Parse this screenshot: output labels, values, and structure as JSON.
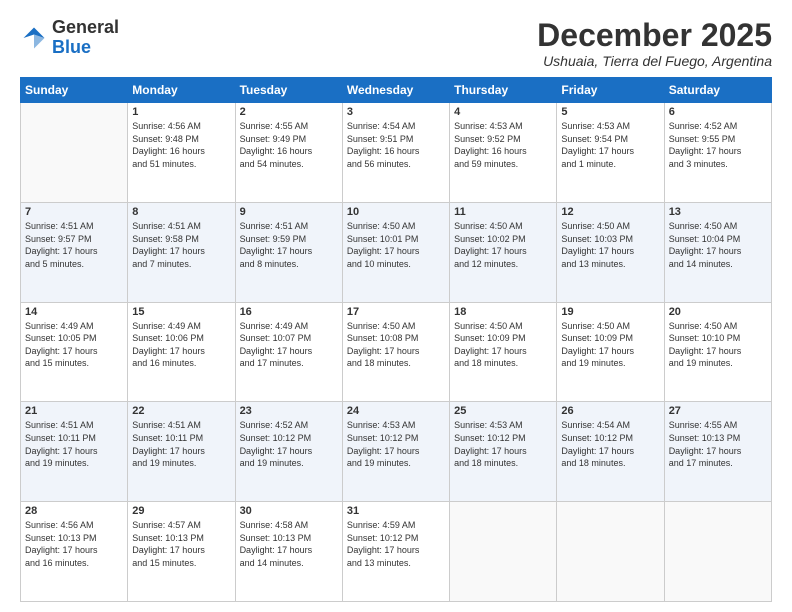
{
  "logo": {
    "general": "General",
    "blue": "Blue"
  },
  "header": {
    "month": "December 2025",
    "subtitle": "Ushuaia, Tierra del Fuego, Argentina"
  },
  "weekdays": [
    "Sunday",
    "Monday",
    "Tuesday",
    "Wednesday",
    "Thursday",
    "Friday",
    "Saturday"
  ],
  "weeks": [
    [
      {
        "day": "",
        "info": ""
      },
      {
        "day": "1",
        "info": "Sunrise: 4:56 AM\nSunset: 9:48 PM\nDaylight: 16 hours\nand 51 minutes."
      },
      {
        "day": "2",
        "info": "Sunrise: 4:55 AM\nSunset: 9:49 PM\nDaylight: 16 hours\nand 54 minutes."
      },
      {
        "day": "3",
        "info": "Sunrise: 4:54 AM\nSunset: 9:51 PM\nDaylight: 16 hours\nand 56 minutes."
      },
      {
        "day": "4",
        "info": "Sunrise: 4:53 AM\nSunset: 9:52 PM\nDaylight: 16 hours\nand 59 minutes."
      },
      {
        "day": "5",
        "info": "Sunrise: 4:53 AM\nSunset: 9:54 PM\nDaylight: 17 hours\nand 1 minute."
      },
      {
        "day": "6",
        "info": "Sunrise: 4:52 AM\nSunset: 9:55 PM\nDaylight: 17 hours\nand 3 minutes."
      }
    ],
    [
      {
        "day": "7",
        "info": "Sunrise: 4:51 AM\nSunset: 9:57 PM\nDaylight: 17 hours\nand 5 minutes."
      },
      {
        "day": "8",
        "info": "Sunrise: 4:51 AM\nSunset: 9:58 PM\nDaylight: 17 hours\nand 7 minutes."
      },
      {
        "day": "9",
        "info": "Sunrise: 4:51 AM\nSunset: 9:59 PM\nDaylight: 17 hours\nand 8 minutes."
      },
      {
        "day": "10",
        "info": "Sunrise: 4:50 AM\nSunset: 10:01 PM\nDaylight: 17 hours\nand 10 minutes."
      },
      {
        "day": "11",
        "info": "Sunrise: 4:50 AM\nSunset: 10:02 PM\nDaylight: 17 hours\nand 12 minutes."
      },
      {
        "day": "12",
        "info": "Sunrise: 4:50 AM\nSunset: 10:03 PM\nDaylight: 17 hours\nand 13 minutes."
      },
      {
        "day": "13",
        "info": "Sunrise: 4:50 AM\nSunset: 10:04 PM\nDaylight: 17 hours\nand 14 minutes."
      }
    ],
    [
      {
        "day": "14",
        "info": "Sunrise: 4:49 AM\nSunset: 10:05 PM\nDaylight: 17 hours\nand 15 minutes."
      },
      {
        "day": "15",
        "info": "Sunrise: 4:49 AM\nSunset: 10:06 PM\nDaylight: 17 hours\nand 16 minutes."
      },
      {
        "day": "16",
        "info": "Sunrise: 4:49 AM\nSunset: 10:07 PM\nDaylight: 17 hours\nand 17 minutes."
      },
      {
        "day": "17",
        "info": "Sunrise: 4:50 AM\nSunset: 10:08 PM\nDaylight: 17 hours\nand 18 minutes."
      },
      {
        "day": "18",
        "info": "Sunrise: 4:50 AM\nSunset: 10:09 PM\nDaylight: 17 hours\nand 18 minutes."
      },
      {
        "day": "19",
        "info": "Sunrise: 4:50 AM\nSunset: 10:09 PM\nDaylight: 17 hours\nand 19 minutes."
      },
      {
        "day": "20",
        "info": "Sunrise: 4:50 AM\nSunset: 10:10 PM\nDaylight: 17 hours\nand 19 minutes."
      }
    ],
    [
      {
        "day": "21",
        "info": "Sunrise: 4:51 AM\nSunset: 10:11 PM\nDaylight: 17 hours\nand 19 minutes."
      },
      {
        "day": "22",
        "info": "Sunrise: 4:51 AM\nSunset: 10:11 PM\nDaylight: 17 hours\nand 19 minutes."
      },
      {
        "day": "23",
        "info": "Sunrise: 4:52 AM\nSunset: 10:12 PM\nDaylight: 17 hours\nand 19 minutes."
      },
      {
        "day": "24",
        "info": "Sunrise: 4:53 AM\nSunset: 10:12 PM\nDaylight: 17 hours\nand 19 minutes."
      },
      {
        "day": "25",
        "info": "Sunrise: 4:53 AM\nSunset: 10:12 PM\nDaylight: 17 hours\nand 18 minutes."
      },
      {
        "day": "26",
        "info": "Sunrise: 4:54 AM\nSunset: 10:12 PM\nDaylight: 17 hours\nand 18 minutes."
      },
      {
        "day": "27",
        "info": "Sunrise: 4:55 AM\nSunset: 10:13 PM\nDaylight: 17 hours\nand 17 minutes."
      }
    ],
    [
      {
        "day": "28",
        "info": "Sunrise: 4:56 AM\nSunset: 10:13 PM\nDaylight: 17 hours\nand 16 minutes."
      },
      {
        "day": "29",
        "info": "Sunrise: 4:57 AM\nSunset: 10:13 PM\nDaylight: 17 hours\nand 15 minutes."
      },
      {
        "day": "30",
        "info": "Sunrise: 4:58 AM\nSunset: 10:13 PM\nDaylight: 17 hours\nand 14 minutes."
      },
      {
        "day": "31",
        "info": "Sunrise: 4:59 AM\nSunset: 10:12 PM\nDaylight: 17 hours\nand 13 minutes."
      },
      {
        "day": "",
        "info": ""
      },
      {
        "day": "",
        "info": ""
      },
      {
        "day": "",
        "info": ""
      }
    ]
  ]
}
